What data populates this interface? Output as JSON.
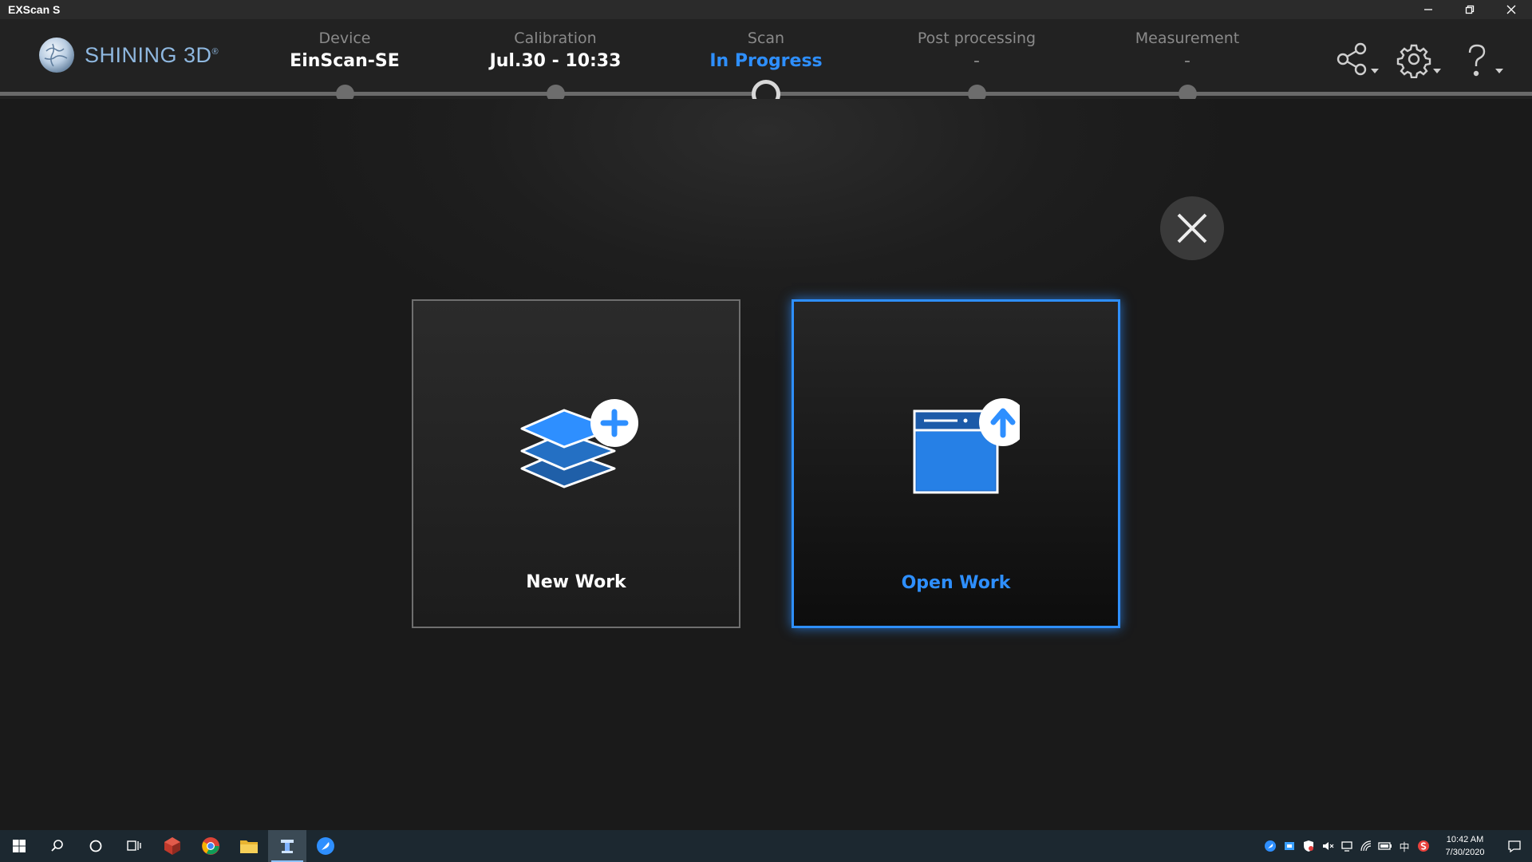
{
  "window": {
    "title": "EXScan S"
  },
  "brand": {
    "name": "SHINING 3D",
    "mark": "®"
  },
  "steps": [
    {
      "label": "Device",
      "value": "EinScan-SE",
      "state": "done"
    },
    {
      "label": "Calibration",
      "value": "Jul.30 - 10:33",
      "state": "done"
    },
    {
      "label": "Scan",
      "value": "In Progress",
      "state": "current"
    },
    {
      "label": "Post processing",
      "value": "-",
      "state": "pending"
    },
    {
      "label": "Measurement",
      "value": "-",
      "state": "pending"
    }
  ],
  "tools": [
    "share-icon",
    "settings-icon",
    "help-icon"
  ],
  "dialog": {
    "new_work": {
      "label": "New Work",
      "icon": "layers-plus-icon"
    },
    "open_work": {
      "label": "Open Work",
      "icon": "window-upload-icon"
    }
  },
  "colors": {
    "accent": "#2e8fff",
    "background": "#1b1b1b"
  },
  "taskbar": {
    "time": "10:42 AM",
    "date": "7/30/2020",
    "ime": "中"
  }
}
